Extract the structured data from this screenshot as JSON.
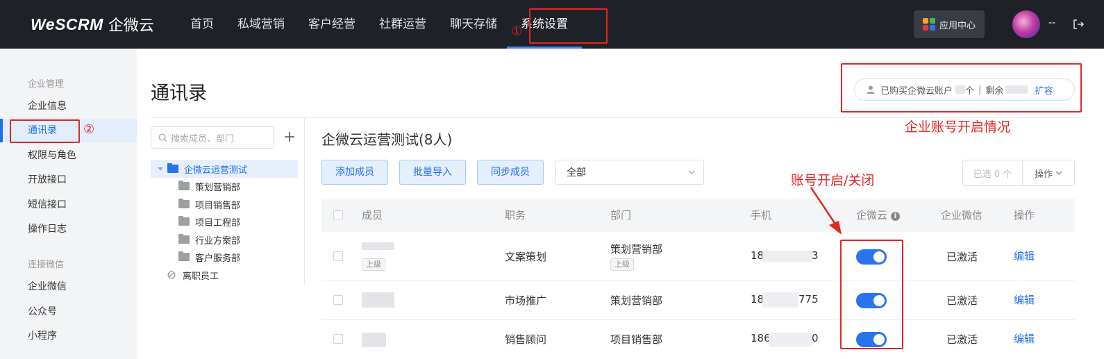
{
  "brand": {
    "logo_text": "WeSCRM",
    "logo_cn": "企微云"
  },
  "nav": {
    "items": [
      {
        "label": "首页"
      },
      {
        "label": "私域营销"
      },
      {
        "label": "客户经营"
      },
      {
        "label": "社群运营"
      },
      {
        "label": "聊天存储"
      },
      {
        "label": "系统设置"
      }
    ],
    "active_index": 5,
    "app_center": "应用中心",
    "user_name": "--"
  },
  "sidebar": {
    "group1": "企业管理",
    "items1": [
      {
        "label": "企业信息"
      },
      {
        "label": "通讯录"
      },
      {
        "label": "权限与角色"
      },
      {
        "label": "开放接口"
      },
      {
        "label": "短信接口"
      },
      {
        "label": "操作日志"
      }
    ],
    "group2": "连接微信",
    "items2": [
      {
        "label": "企业微信"
      },
      {
        "label": "公众号"
      },
      {
        "label": "小程序"
      }
    ]
  },
  "page": {
    "title": "通讯录",
    "quota_prefix": "已购买企微云账户",
    "quota_unit": "个",
    "quota_divider": "|",
    "quota_remaining": "剩余",
    "quota_expand": "扩容"
  },
  "dept_tree": {
    "search_placeholder": "搜索成员、部门",
    "add_symbol": "+",
    "root": "企微云运营测试",
    "children": [
      {
        "label": "策划营销部"
      },
      {
        "label": "项目销售部"
      },
      {
        "label": "项目工程部"
      },
      {
        "label": "行业方案部"
      },
      {
        "label": "客户服务部"
      }
    ],
    "resigned": "离职员工"
  },
  "toolbar": {
    "heading": "企微云运营测试(8人)",
    "add_member": "添加成员",
    "batch_import": "批量导入",
    "sync_member": "同步成员",
    "filter_value": "全部",
    "selected": "已选 0 个",
    "operation": "操作"
  },
  "table": {
    "headers": {
      "member": "成员",
      "position": "职务",
      "department": "部门",
      "phone": "手机",
      "qiweiyun": "企微云",
      "wecom": "企业微信",
      "actions": "操作"
    },
    "rows": [
      {
        "position": "文案策划",
        "department": "策划营销部",
        "member_tag": "上级",
        "dept_tag": "上级",
        "phone_prefix": "18",
        "phone_suffix": "3",
        "wecom_status": "已激活",
        "action": "编辑",
        "enabled": true
      },
      {
        "position": "市场推广",
        "department": "策划营销部",
        "member_tag": "",
        "dept_tag": "",
        "phone_prefix": "18",
        "phone_suffix": "775",
        "wecom_status": "已激活",
        "action": "编辑",
        "enabled": true
      },
      {
        "position": "销售顾问",
        "department": "项目销售部",
        "member_tag": "",
        "dept_tag": "",
        "phone_prefix": "186",
        "phone_suffix": "0",
        "wecom_status": "已激活",
        "action": "编辑",
        "enabled": true
      }
    ]
  },
  "annotations": {
    "step1": "①",
    "step2": "②",
    "quota_note": "企业账号开启情况",
    "toggle_note": "账号开启/关闭"
  }
}
